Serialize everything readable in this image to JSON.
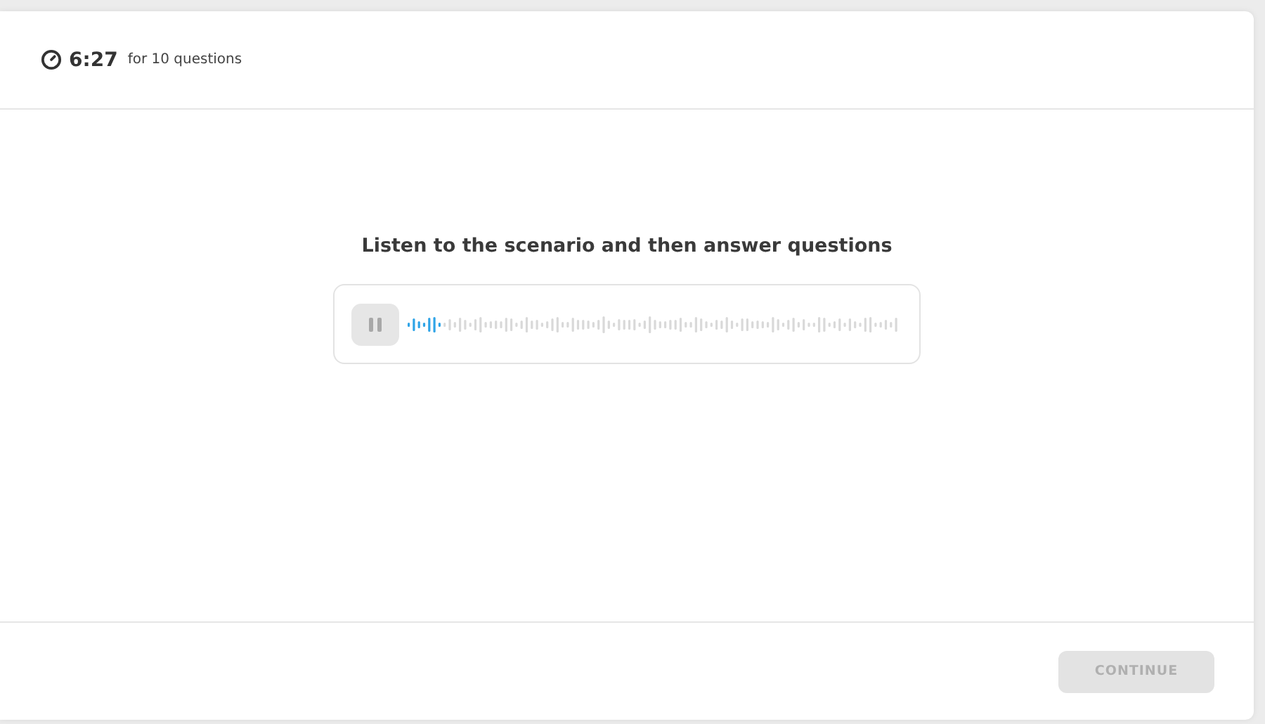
{
  "header": {
    "timer": "6:27",
    "timer_note": "for 10 questions"
  },
  "prompt": "Listen to the scenario and then answer questions",
  "player": {
    "playing": true,
    "level": 0.07
  },
  "continue_button": {
    "label": "CONTINUE",
    "disabled": true
  }
}
